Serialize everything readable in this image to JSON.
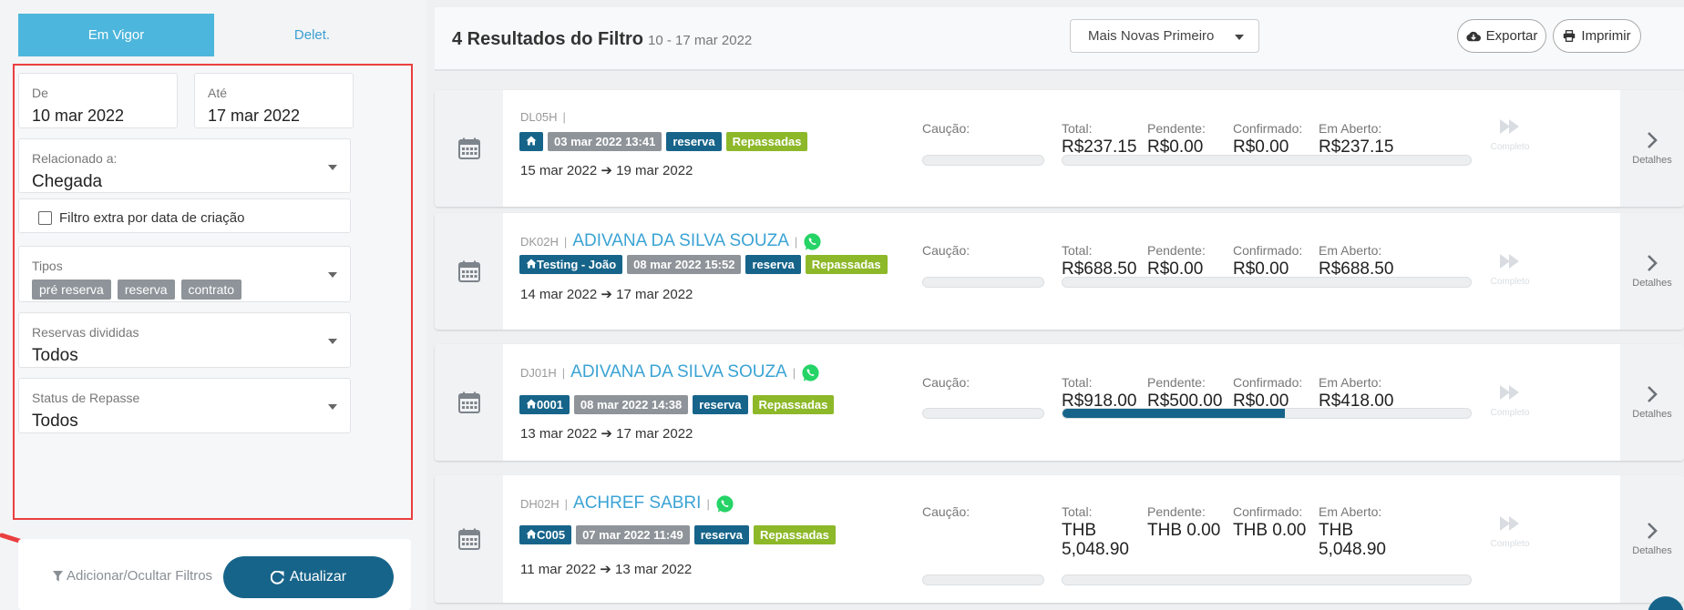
{
  "sidebar": {
    "tabs": [
      {
        "label": "Em Vigor",
        "active": true
      },
      {
        "label": "Delet.",
        "active": false
      }
    ],
    "filters": {
      "from": {
        "label": "De",
        "value": "10 mar 2022"
      },
      "to": {
        "label": "Até",
        "value": "17 mar 2022"
      },
      "related": {
        "label": "Relacionado a:",
        "value": "Chegada"
      },
      "extra_filter": {
        "label": "Filtro extra por data de criação",
        "checked": false
      },
      "types": {
        "label": "Tipos",
        "tags": [
          "pré reserva",
          "reserva",
          "contrato"
        ]
      },
      "split": {
        "label": "Reservas divididas",
        "value": "Todos"
      },
      "repasse": {
        "label": "Status de Repasse",
        "value": "Todos"
      }
    },
    "add_hide_filters": "Adicionar/Ocultar Filtros",
    "update_button": "Atualizar"
  },
  "header": {
    "title": "4 Resultados do Filtro",
    "range": "10 - 17 mar 2022",
    "sort": "Mais Novas Primeiro",
    "export": "Exportar",
    "print": "Imprimir"
  },
  "labels": {
    "caucao": "Caução:",
    "total": "Total:",
    "pendente": "Pendente:",
    "confirmado": "Confirmado:",
    "em_aberto": "Em Aberto:",
    "completo": "Completo",
    "detalhes": "Detalhes"
  },
  "colors": {
    "accent": "#4db6dc",
    "primary": "#17648a",
    "green": "#8db829",
    "highlight": "#ea3f3f",
    "whatsapp": "#25d366"
  },
  "reservations": [
    {
      "code": "DL05H",
      "name": "",
      "property": "",
      "created": "03 mar 2022 13:41",
      "type": "reserva",
      "status": "Repassadas",
      "checkin": "15 mar 2022",
      "checkout": "19 mar 2022",
      "total": "R$237.15",
      "pendente": "R$0.00",
      "confirmado": "R$0.00",
      "aberto": "R$237.15",
      "paid_fraction": 0
    },
    {
      "code": "DK02H",
      "name": "ADIVANA DA SILVA SOUZA",
      "property": "Testing - João",
      "created": "08 mar 2022 15:52",
      "type": "reserva",
      "status": "Repassadas",
      "checkin": "14 mar 2022",
      "checkout": "17 mar 2022",
      "total": "R$688.50",
      "pendente": "R$0.00",
      "confirmado": "R$0.00",
      "aberto": "R$688.50",
      "paid_fraction": 0
    },
    {
      "code": "DJ01H",
      "name": "ADIVANA DA SILVA SOUZA",
      "property": "0001",
      "created": "08 mar 2022 14:38",
      "type": "reserva",
      "status": "Repassadas",
      "checkin": "13 mar 2022",
      "checkout": "17 mar 2022",
      "total": "R$918.00",
      "pendente": "R$500.00",
      "confirmado": "R$0.00",
      "aberto": "R$418.00",
      "paid_fraction": 0.545
    },
    {
      "code": "DH02H",
      "name": "ACHREF SABRI",
      "property": "C005",
      "created": "07 mar 2022 11:49",
      "type": "reserva",
      "status": "Repassadas",
      "checkin": "11 mar 2022",
      "checkout": "13 mar 2022",
      "total": "THB 5,048.90",
      "pendente": "THB 0.00",
      "confirmado": "THB 0.00",
      "aberto": "THB 5,048.90",
      "paid_fraction": 0
    }
  ]
}
